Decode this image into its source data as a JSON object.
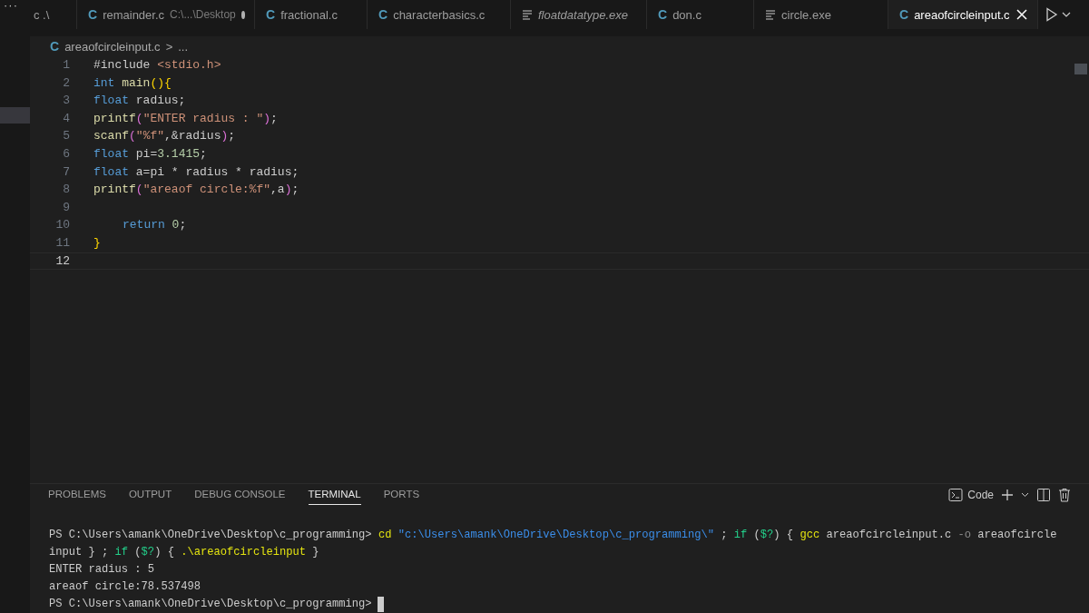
{
  "activity_bar": {
    "more": "···"
  },
  "tabs": [
    {
      "label": "c .\\",
      "kind": "cut",
      "selected": false,
      "italic": false,
      "dirty": false
    },
    {
      "label": "remainder.c",
      "description": "C:\\...\\Desktop",
      "kind": "source",
      "glyph": "C",
      "selected": false,
      "italic": false,
      "dirty": true
    },
    {
      "label": "fractional.c",
      "kind": "source",
      "glyph": "C",
      "selected": false,
      "italic": false,
      "dirty": false
    },
    {
      "label": "characterbasics.c",
      "kind": "source",
      "glyph": "C",
      "selected": false,
      "italic": false,
      "dirty": false
    },
    {
      "label": "floatdatatype.exe",
      "kind": "binary",
      "selected": false,
      "italic": true,
      "dirty": false
    },
    {
      "label": "don.c",
      "kind": "source",
      "glyph": "C",
      "selected": false,
      "italic": false,
      "dirty": false
    },
    {
      "label": "circle.exe",
      "kind": "binary",
      "selected": false,
      "italic": false,
      "dirty": false
    },
    {
      "label": "areaofcircleinput.c",
      "kind": "source",
      "glyph": "C",
      "selected": true,
      "italic": false,
      "dirty": false
    }
  ],
  "breadcrumb": {
    "glyph": "C",
    "file": "areaofcircleinput.c",
    "separator": ">",
    "rest": "..."
  },
  "code_lines": [
    {
      "number": "1",
      "tokens": [
        {
          "text": "#include ",
          "kind": "plain"
        },
        {
          "text": "<stdio.h>",
          "kind": "string"
        }
      ]
    },
    {
      "number": "2",
      "tokens": [
        {
          "text": "int",
          "kind": "keyword"
        },
        {
          "text": " main",
          "kind": "func"
        },
        {
          "text": "(){",
          "kind": "bracket1"
        }
      ]
    },
    {
      "number": "3",
      "tokens": [
        {
          "text": "float",
          "kind": "keyword"
        },
        {
          "text": " radius;",
          "kind": "plain"
        }
      ]
    },
    {
      "number": "4",
      "tokens": [
        {
          "text": "printf",
          "kind": "func"
        },
        {
          "text": "(",
          "kind": "bracket2"
        },
        {
          "text": "\"ENTER radius : \"",
          "kind": "string"
        },
        {
          "text": ")",
          "kind": "bracket2"
        },
        {
          "text": ";",
          "kind": "plain"
        }
      ]
    },
    {
      "number": "5",
      "tokens": [
        {
          "text": "scanf",
          "kind": "func"
        },
        {
          "text": "(",
          "kind": "bracket2"
        },
        {
          "text": "\"%f\"",
          "kind": "string"
        },
        {
          "text": ",&radius",
          "kind": "plain"
        },
        {
          "text": ")",
          "kind": "bracket2"
        },
        {
          "text": ";",
          "kind": "plain"
        }
      ]
    },
    {
      "number": "6",
      "tokens": [
        {
          "text": "float",
          "kind": "keyword"
        },
        {
          "text": " pi=",
          "kind": "plain"
        },
        {
          "text": "3.1415",
          "kind": "number"
        },
        {
          "text": ";",
          "kind": "plain"
        }
      ]
    },
    {
      "number": "7",
      "tokens": [
        {
          "text": "float",
          "kind": "keyword"
        },
        {
          "text": " a=pi * radius * radius;",
          "kind": "plain"
        }
      ]
    },
    {
      "number": "8",
      "tokens": [
        {
          "text": "printf",
          "kind": "func"
        },
        {
          "text": "(",
          "kind": "bracket2"
        },
        {
          "text": "\"areaof circle:%f\"",
          "kind": "string"
        },
        {
          "text": ",a",
          "kind": "plain"
        },
        {
          "text": ")",
          "kind": "bracket2"
        },
        {
          "text": ";",
          "kind": "plain"
        }
      ]
    },
    {
      "number": "9"
    },
    {
      "number": "10",
      "indented": true,
      "tokens": [
        {
          "text": "return",
          "kind": "keyword"
        },
        {
          "text": " 0",
          "kind": "number"
        },
        {
          "text": ";",
          "kind": "plain"
        }
      ]
    },
    {
      "number": "11",
      "tokens": [
        {
          "text": "}",
          "kind": "bracket1"
        }
      ]
    },
    {
      "number": "12",
      "current": true
    }
  ],
  "panel_tabs": [
    {
      "label": "PROBLEMS",
      "selected": false
    },
    {
      "label": "OUTPUT",
      "selected": false
    },
    {
      "label": "DEBUG CONSOLE",
      "selected": false
    },
    {
      "label": "TERMINAL",
      "selected": true
    },
    {
      "label": "PORTS",
      "selected": false
    }
  ],
  "terminal_profile": "Code",
  "terminal_lines": [
    {
      "tokens": [
        {
          "text": "PS C:\\Users\\amank\\OneDrive\\Desktop\\c_programming> ",
          "kind": "plain"
        },
        {
          "text": "cd",
          "kind": "command"
        },
        {
          "text": " \"c:\\Users\\amank\\OneDrive\\Desktop\\c_programming\\\"",
          "kind": "string"
        },
        {
          "text": " ; ",
          "kind": "plain"
        },
        {
          "text": "if",
          "kind": "keyword"
        },
        {
          "text": " (",
          "kind": "plain"
        },
        {
          "text": "$?",
          "kind": "keyword"
        },
        {
          "text": ") { ",
          "kind": "plain"
        },
        {
          "text": "gcc",
          "kind": "command"
        },
        {
          "text": " areaofcircleinput.c ",
          "kind": "plain"
        },
        {
          "text": "-o",
          "kind": "flag"
        },
        {
          "text": " areaofcircle",
          "kind": "plain"
        }
      ]
    },
    {
      "tokens": [
        {
          "text": "input } ; ",
          "kind": "plain"
        },
        {
          "text": "if",
          "kind": "keyword"
        },
        {
          "text": " (",
          "kind": "plain"
        },
        {
          "text": "$?",
          "kind": "keyword"
        },
        {
          "text": ") { ",
          "kind": "plain"
        },
        {
          "text": ".\\areaofcircleinput",
          "kind": "command"
        },
        {
          "text": " }",
          "kind": "plain"
        }
      ]
    },
    {
      "tokens": [
        {
          "text": "ENTER radius : 5",
          "kind": "plain"
        }
      ]
    },
    {
      "tokens": [
        {
          "text": "areaof circle:78.537498",
          "kind": "plain"
        }
      ]
    },
    {
      "tokens": [
        {
          "text": "PS C:\\Users\\amank\\OneDrive\\Desktop\\c_programming>",
          "kind": "plain"
        }
      ],
      "cursor": true
    }
  ]
}
